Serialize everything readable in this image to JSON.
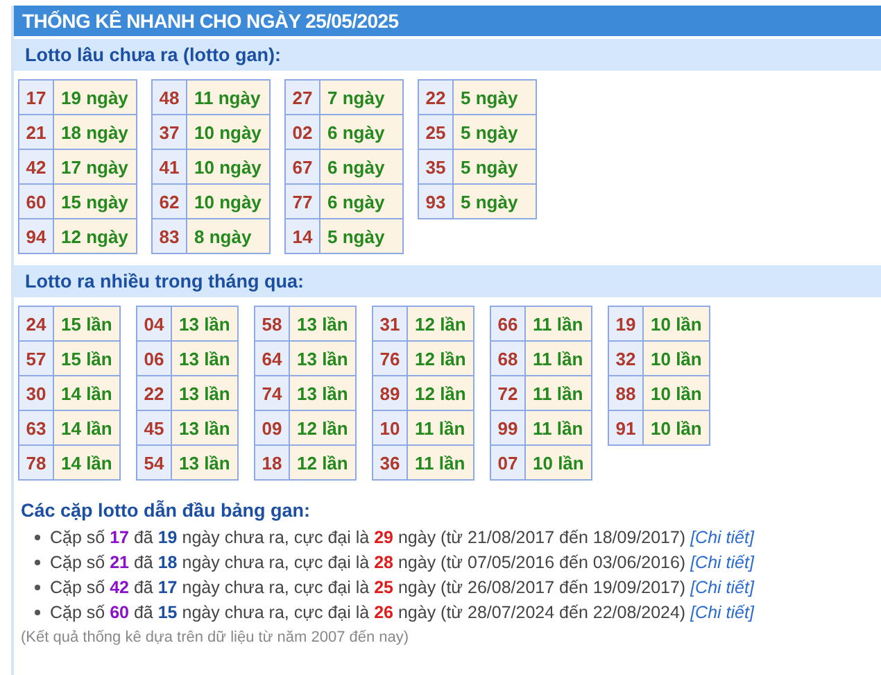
{
  "title": "THỐNG KÊ NHANH CHO NGÀY 25/05/2025",
  "sections": [
    {
      "title": "Lotto lâu chưa ra (lotto gan):",
      "kind": "gan",
      "groups": [
        {
          "rows": [
            {
              "number": "17",
              "count": "19 ngày"
            },
            {
              "number": "21",
              "count": "18 ngày"
            },
            {
              "number": "42",
              "count": "17 ngày"
            },
            {
              "number": "60",
              "count": "15 ngày"
            },
            {
              "number": "94",
              "count": "12 ngày"
            }
          ]
        },
        {
          "rows": [
            {
              "number": "48",
              "count": "11 ngày"
            },
            {
              "number": "37",
              "count": "10 ngày"
            },
            {
              "number": "41",
              "count": "10 ngày"
            },
            {
              "number": "62",
              "count": "10 ngày"
            },
            {
              "number": "83",
              "count": "8 ngày"
            }
          ]
        },
        {
          "rows": [
            {
              "number": "27",
              "count": "7 ngày"
            },
            {
              "number": "02",
              "count": "6 ngày"
            },
            {
              "number": "67",
              "count": "6 ngày"
            },
            {
              "number": "77",
              "count": "6 ngày"
            },
            {
              "number": "14",
              "count": "5 ngày"
            }
          ]
        },
        {
          "rows": [
            {
              "number": "22",
              "count": "5 ngày"
            },
            {
              "number": "25",
              "count": "5 ngày"
            },
            {
              "number": "35",
              "count": "5 ngày"
            },
            {
              "number": "93",
              "count": "5 ngày"
            }
          ]
        }
      ]
    },
    {
      "title": "Lotto ra nhiều trong tháng qua:",
      "kind": "frequent",
      "groups": [
        {
          "rows": [
            {
              "number": "24",
              "count": "15 lần"
            },
            {
              "number": "57",
              "count": "15 lần"
            },
            {
              "number": "30",
              "count": "14 lần"
            },
            {
              "number": "63",
              "count": "14 lần"
            },
            {
              "number": "78",
              "count": "14 lần"
            }
          ]
        },
        {
          "rows": [
            {
              "number": "04",
              "count": "13 lần"
            },
            {
              "number": "06",
              "count": "13 lần"
            },
            {
              "number": "22",
              "count": "13 lần"
            },
            {
              "number": "45",
              "count": "13 lần"
            },
            {
              "number": "54",
              "count": "13 lần"
            }
          ]
        },
        {
          "rows": [
            {
              "number": "58",
              "count": "13 lần"
            },
            {
              "number": "64",
              "count": "13 lần"
            },
            {
              "number": "74",
              "count": "13 lần"
            },
            {
              "number": "09",
              "count": "12 lần"
            },
            {
              "number": "18",
              "count": "12 lần"
            }
          ]
        },
        {
          "rows": [
            {
              "number": "31",
              "count": "12 lần"
            },
            {
              "number": "76",
              "count": "12 lần"
            },
            {
              "number": "89",
              "count": "12 lần"
            },
            {
              "number": "10",
              "count": "11 lần"
            },
            {
              "number": "36",
              "count": "11 lần"
            }
          ]
        },
        {
          "rows": [
            {
              "number": "66",
              "count": "11 lần"
            },
            {
              "number": "68",
              "count": "11 lần"
            },
            {
              "number": "72",
              "count": "11 lần"
            },
            {
              "number": "99",
              "count": "11 lần"
            },
            {
              "number": "07",
              "count": "10 lần"
            }
          ]
        },
        {
          "rows": [
            {
              "number": "19",
              "count": "10 lần"
            },
            {
              "number": "32",
              "count": "10 lần"
            },
            {
              "number": "88",
              "count": "10 lần"
            },
            {
              "number": "91",
              "count": "10 lần"
            }
          ]
        }
      ]
    }
  ],
  "pairs": {
    "title": "Các cặp lotto dẫn đầu bảng gan:",
    "items": [
      {
        "parts": [
          {
            "kind": "plain",
            "text": "Cặp số "
          },
          {
            "kind": "pair",
            "text": "17"
          },
          {
            "kind": "plain",
            "text": " đã "
          },
          {
            "kind": "days",
            "text": "19"
          },
          {
            "kind": "plain",
            "text": " ngày chưa ra, cực đại là "
          },
          {
            "kind": "max",
            "text": "29"
          },
          {
            "kind": "plain",
            "text": " ngày (từ 21/08/2017 đến 18/09/2017) "
          }
        ],
        "link": "[Chi tiết]"
      },
      {
        "parts": [
          {
            "kind": "plain",
            "text": "Cặp số "
          },
          {
            "kind": "pair",
            "text": "21"
          },
          {
            "kind": "plain",
            "text": " đã "
          },
          {
            "kind": "days",
            "text": "18"
          },
          {
            "kind": "plain",
            "text": " ngày chưa ra, cực đại là "
          },
          {
            "kind": "max",
            "text": "28"
          },
          {
            "kind": "plain",
            "text": " ngày (từ 07/05/2016 đến 03/06/2016) "
          }
        ],
        "link": "[Chi tiết]"
      },
      {
        "parts": [
          {
            "kind": "plain",
            "text": "Cặp số "
          },
          {
            "kind": "pair",
            "text": "42"
          },
          {
            "kind": "plain",
            "text": " đã "
          },
          {
            "kind": "days",
            "text": "17"
          },
          {
            "kind": "plain",
            "text": " ngày chưa ra, cực đại là "
          },
          {
            "kind": "max",
            "text": "25"
          },
          {
            "kind": "plain",
            "text": " ngày (từ 26/08/2017 đến 19/09/2017) "
          }
        ],
        "link": "[Chi tiết]"
      },
      {
        "parts": [
          {
            "kind": "plain",
            "text": "Cặp số "
          },
          {
            "kind": "pair",
            "text": "60"
          },
          {
            "kind": "plain",
            "text": " đã "
          },
          {
            "kind": "days",
            "text": "15"
          },
          {
            "kind": "plain",
            "text": " ngày chưa ra, cực đại là "
          },
          {
            "kind": "max",
            "text": "26"
          },
          {
            "kind": "plain",
            "text": " ngày (từ 28/07/2024 đến 22/08/2024) "
          }
        ],
        "link": "[Chi tiết]"
      }
    ],
    "note": "(Kết quả thống kê dựa trên dữ liệu từ năm 2007 đến nay)"
  }
}
